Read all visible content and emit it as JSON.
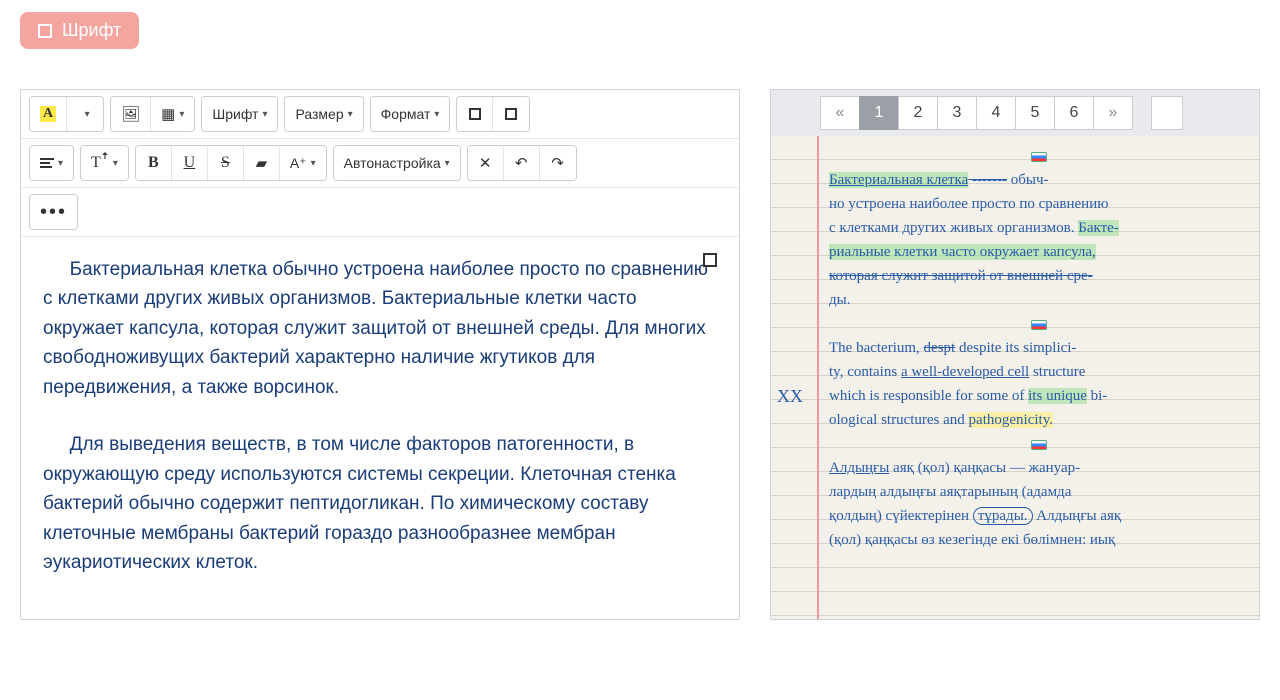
{
  "topButton": {
    "label": "Шрифт"
  },
  "toolbar": {
    "row1": {
      "font": "Шрифт",
      "size": "Размер",
      "format": "Формат"
    },
    "row2": {
      "auto": "Автонастройка"
    },
    "letters": {
      "A": "A",
      "B": "B",
      "U": "U",
      "S": "S",
      "T": "T",
      "Aplus": "A⁺"
    }
  },
  "editor": {
    "p1": "Бактериальная клетка обычно устроена наиболее просто по сравнению с клетками других живых организмов. Бактериальные клетки часто окружает капсула, которая служит защитой от внешней среды. Для многих свободноживущих бактерий характерно наличие жгутиков для передвижения, а также ворсинок.",
    "p2": "Для выведения веществ, в том числе факторов патогенности, в окружающую среду используются системы секреции. Клеточная стенка бактерий обычно содержит пептидогликан. По химическому составу клеточные мембраны бактерий гораздо разнообразнее мембран эукариотических клеток."
  },
  "pager": {
    "prev": "«",
    "next": "»",
    "pages": [
      "1",
      "2",
      "3",
      "4",
      "5",
      "6"
    ],
    "active": "1"
  },
  "handwriting": {
    "l1a": "Бактериальная клетка",
    "l1b": " обыч-",
    "l2": "но устроена наиболее просто по сравнению",
    "l3a": "с клетками других живых организмов. ",
    "l3b": "Бакте-",
    "l4a": "риальные клетки часто ",
    "l4b": "окружает капсула,",
    "l5": "которая служит защитой от внешней сре-",
    "l6": "ды.",
    "l7a": "The bacterium, ",
    "l7b": "despt",
    "l7c": " despite  its simplici-",
    "l8a": "ty, contains ",
    "l8b": "a well-developed cell",
    "l8c": " structure",
    "l9a": "which is responsible for some of ",
    "l9b": "its unique",
    "l9c": " bi-",
    "l10a": "ological structures and ",
    "l10b": "pathogenicity.",
    "l11a": "Алдыңғы",
    "l11b": " аяқ (қол) қаңқасы — жануар-",
    "l12": "лардың алдыңғы аяқтарының (адамда",
    "l13a": "қолдың) сүйектерінен ",
    "l13b": "тұрады.",
    "l13c": " Алдыңғы аяқ",
    "l14": "(қол) қаңқасы өз кезегінде екі бөлімнен: иық"
  },
  "marginNotes": {
    "xx": "XX"
  }
}
